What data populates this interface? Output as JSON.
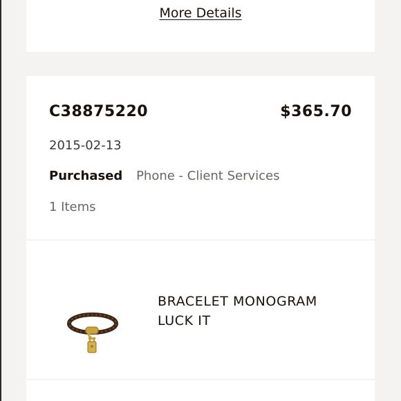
{
  "top_card": {
    "more_details_label": "More Details"
  },
  "order": {
    "id": "C38875220",
    "price": "$365.70",
    "date": "2015-02-13",
    "status": "Purchased",
    "channel": "Phone - Client Services",
    "item_count": "1 Items"
  },
  "item": {
    "name": "BRACELET MONOGRAM LUCK IT",
    "image_icon": "bracelet-icon"
  },
  "colors": {
    "background": "#f4f3f1",
    "card": "#ffffff",
    "text_primary": "#19110b",
    "text_secondary": "#6b6561"
  }
}
